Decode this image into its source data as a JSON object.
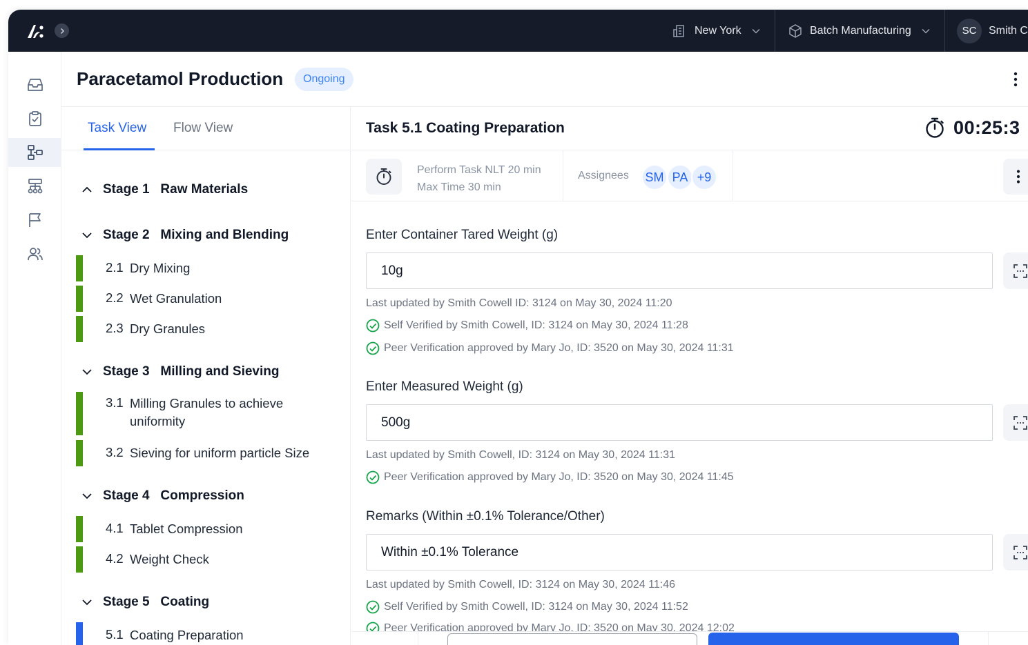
{
  "topbar": {
    "location": "New York",
    "department": "Batch Manufacturing",
    "user_initials": "SC",
    "user_name": "Smith C"
  },
  "rail": {
    "items": [
      "inbox-icon",
      "clipboard-check-icon",
      "process-flow-icon",
      "hierarchy-icon",
      "flag-icon",
      "users-icon"
    ]
  },
  "header": {
    "title": "Paracetamol Production",
    "status": "Ongoing"
  },
  "tabs": {
    "task_view": "Task View",
    "flow_view": "Flow View"
  },
  "stages": [
    {
      "label": "Stage 1   Raw Materials",
      "tasks": []
    },
    {
      "label": "Stage 2   Mixing and Blending",
      "tasks": [
        {
          "num": "2.1",
          "name": "Dry Mixing"
        },
        {
          "num": "2.2",
          "name": "Wet Granulation"
        },
        {
          "num": "2.3",
          "name": "Dry Granules"
        }
      ]
    },
    {
      "label": "Stage 3   Milling and Sieving",
      "tasks": [
        {
          "num": "3.1",
          "name_line1": "Milling Granules to achieve",
          "name_line2": "uniformity"
        },
        {
          "num": "3.2",
          "name": "Sieving for uniform particle Size"
        }
      ]
    },
    {
      "label": "Stage 4   Compression",
      "tasks": [
        {
          "num": "4.1",
          "name": "Tablet Compression"
        },
        {
          "num": "4.2",
          "name": "Weight Check"
        }
      ]
    },
    {
      "label": "Stage 5   Coating",
      "tasks": [
        {
          "num": "5.1",
          "name": "Coating Preparation"
        }
      ]
    }
  ],
  "task": {
    "title": "Task 5.1 Coating Preparation",
    "timer": "00:25:3",
    "perform": "Perform Task NLT 20 min",
    "max_time": "Max Time 30 min",
    "assignees_label": "Assignees",
    "assignees": [
      "SM",
      "PA",
      "+9"
    ]
  },
  "fields": [
    {
      "label": "Enter Container Tared Weight (g)",
      "value": "10g",
      "updated": "Last updated by Smith Cowell ID: 3124 on May 30, 2024 11:20",
      "verifications": [
        "Self Verified by Smith Cowell, ID: 3124 on May 30, 2024 11:28",
        "Peer Verification approved by Mary Jo, ID: 3520 on May 30, 2024 11:31"
      ]
    },
    {
      "label": "Enter Measured Weight (g)",
      "value": "500g",
      "updated": "Last updated by Smith Cowell, ID: 3124 on May 30, 2024 11:31",
      "verifications": [
        "Peer Verification approved by Mary Jo, ID: 3520 on May 30, 2024 11:45"
      ]
    },
    {
      "label": "Remarks (Within ±0.1% Tolerance/Other)",
      "value": "Within ±0.1% Tolerance",
      "updated": "Last updated by Smith Cowell, ID: 3124 on May 30, 2024 11:46",
      "verifications": [
        "Self Verified by Smith Cowell, ID: 3124 on May 30, 2024 11:52",
        "Peer Verification approved by Mary Jo, ID: 3520 on May 30, 2024 12:02"
      ]
    }
  ],
  "colors": {
    "topbar": "#151b28",
    "accent": "#2563eb",
    "done": "#4d9a12",
    "verified": "#16a34a"
  }
}
